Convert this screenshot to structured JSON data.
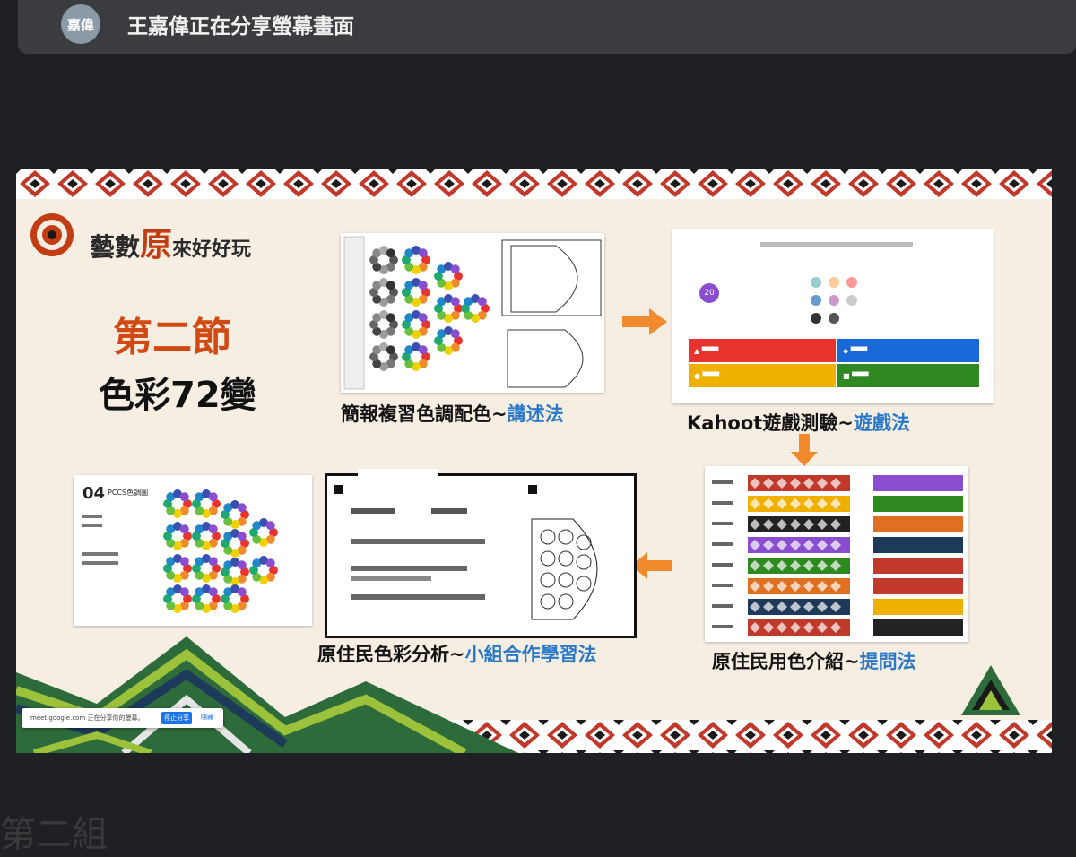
{
  "share_bar": {
    "avatar_label": "嘉偉",
    "title": "王嘉偉正在分享螢幕畫面"
  },
  "slide": {
    "logo_prefix": "藝數",
    "logo_big": "原",
    "logo_suffix": "來好好玩",
    "section": "第二節",
    "subtitle": "色彩72變",
    "step1": {
      "caption": "簡報複習色調配色~",
      "method": "講述法"
    },
    "step2": {
      "caption": "Kahoot遊戲測驗~",
      "method": "遊戲法"
    },
    "step3": {
      "caption": "原住民用色介紹~",
      "method": "提問法"
    },
    "step4": {
      "caption": "原住民色彩分析~",
      "method": "小組合作學習法"
    },
    "kahoot": {
      "timer": "20"
    },
    "pccs": {
      "number": "04",
      "label": "PCCS色調圖"
    },
    "toast": {
      "message": "meet.google.com 正在分享你的螢幕。",
      "stop_label": "停止分享",
      "hide_label": "隱藏"
    }
  },
  "watermark": "第二組",
  "colors": {
    "accent_red": "#d24a13",
    "method_blue": "#2a78c8",
    "arrow_orange": "#f08a2c",
    "kahoot_red": "#e8332e",
    "kahoot_blue": "#1868d8",
    "kahoot_yellow": "#f0b000",
    "kahoot_green": "#2e8a20"
  }
}
